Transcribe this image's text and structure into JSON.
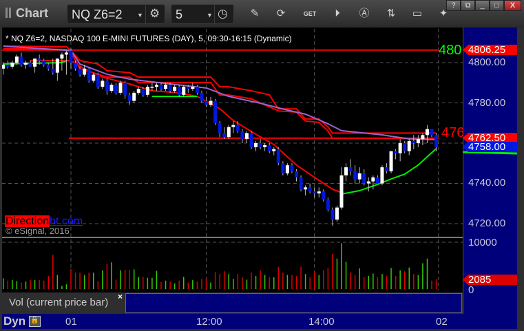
{
  "window": {
    "title": "Chart",
    "buttons": [
      "?",
      "⧉",
      "_",
      "□",
      "X"
    ]
  },
  "toolbar": {
    "symbol": "NQ Z6=2",
    "interval": "5",
    "icons": [
      "gear-icon",
      "clock-icon",
      "pencil-icon",
      "chart-refresh-icon",
      "get-icon",
      "play-icon",
      "alert-icon",
      "swap-icon",
      "comment-icon",
      "twitter-icon"
    ]
  },
  "header": "* NQ Z6=2, NASDAQ 100 E-MINI FUTURES (DAY), 5, 09:30-16:15 (Dynamic)",
  "watermark": {
    "part1": "Direction",
    "part2": "ht.com",
    "copyright": "© eSignal, 2016"
  },
  "study_legend": {
    "label": "Vol (current price bar)",
    "close": "×"
  },
  "time_axis": {
    "mode": "Dyn",
    "labels": [
      "01",
      "12:00",
      "14:00",
      "02"
    ]
  },
  "price_axis": {
    "labels": [
      "4800.00",
      "4780.00",
      "4740.00",
      "4720.00"
    ],
    "flags": [
      {
        "text": "4806.25",
        "color": "#ff0000"
      },
      {
        "text": "4762.50",
        "color": "#ff0000"
      },
      {
        "text": "4758.00",
        "color": "#0018e0"
      }
    ],
    "line_labels": [
      {
        "text": "480",
        "color": "#00ff00"
      },
      {
        "text": "476",
        "color": "#ff0000"
      }
    ]
  },
  "volume_axis": {
    "labels": [
      "10000",
      "0"
    ],
    "flag": "2085"
  },
  "chart_data": {
    "type": "candlestick",
    "ylim": [
      4714,
      4818
    ],
    "grid": true,
    "colors": {
      "up": "#ffffff",
      "down": "#0018e0",
      "vol_up": "#33cc00",
      "vol_down": "#dd0000"
    },
    "bar_index_start": -15,
    "bars": [
      [
        4797,
        4800,
        4794,
        4799
      ],
      [
        4799,
        4801,
        4797,
        4798
      ],
      [
        4798,
        4801,
        4797,
        4800
      ],
      [
        4800,
        4804,
        4799,
        4803
      ],
      [
        4803,
        4805,
        4798,
        4799
      ],
      [
        4799,
        4801,
        4797,
        4800
      ],
      [
        4800,
        4801,
        4798,
        4798
      ],
      [
        4798,
        4802,
        4795,
        4802
      ],
      [
        4802,
        4804,
        4799,
        4801
      ],
      [
        4801,
        4802,
        4798,
        4799
      ],
      [
        4799,
        4800,
        4796,
        4797
      ],
      [
        4797,
        4802,
        4794,
        4795
      ],
      [
        4795,
        4802,
        4791,
        4802
      ],
      [
        4802,
        4805,
        4796,
        4804
      ],
      [
        4804,
        4806,
        4794,
        4805
      ],
      [
        4806,
        4807,
        4797,
        4800
      ],
      [
        4800,
        4801,
        4796,
        4797
      ],
      [
        4797,
        4798,
        4793,
        4794
      ],
      [
        4794,
        4799,
        4793,
        4797
      ],
      [
        4797,
        4798,
        4790,
        4791
      ],
      [
        4791,
        4795,
        4790,
        4794
      ],
      [
        4794,
        4795,
        4787,
        4788
      ],
      [
        4788,
        4792,
        4787,
        4791
      ],
      [
        4791,
        4792,
        4784,
        4786
      ],
      [
        4786,
        4790,
        4785,
        4789
      ],
      [
        4789,
        4790,
        4784,
        4785
      ],
      [
        4785,
        4791,
        4784,
        4790
      ],
      [
        4790,
        4791,
        4782,
        4784
      ],
      [
        4784,
        4785,
        4779,
        4781
      ],
      [
        4781,
        4786,
        4780,
        4785
      ],
      [
        4785,
        4788,
        4784,
        4787
      ],
      [
        4787,
        4788,
        4783,
        4784
      ],
      [
        4784,
        4789,
        4783,
        4788
      ],
      [
        4788,
        4790,
        4786,
        4788
      ],
      [
        4788,
        4790,
        4786,
        4789
      ],
      [
        4789,
        4790,
        4786,
        4787
      ],
      [
        4787,
        4790,
        4786,
        4789
      ],
      [
        4789,
        4790,
        4785,
        4786
      ],
      [
        4786,
        4789,
        4785,
        4788
      ],
      [
        4788,
        4789,
        4783,
        4784
      ],
      [
        4784,
        4789,
        4783,
        4788
      ],
      [
        4788,
        4789,
        4785,
        4787
      ],
      [
        4787,
        4790,
        4786,
        4788
      ],
      [
        4788,
        4789,
        4784,
        4785
      ],
      [
        4785,
        4786,
        4780,
        4781
      ],
      [
        4781,
        4783,
        4778,
        4779
      ],
      [
        4779,
        4783,
        4778,
        4781
      ],
      [
        4781,
        4782,
        4769,
        4770
      ],
      [
        4770,
        4771,
        4763,
        4765
      ],
      [
        4765,
        4768,
        4762,
        4763
      ],
      [
        4763,
        4769,
        4762,
        4768
      ],
      [
        4768,
        4771,
        4765,
        4769
      ],
      [
        4769,
        4771,
        4765,
        4766
      ],
      [
        4766,
        4767,
        4760,
        4762
      ],
      [
        4762,
        4766,
        4760,
        4765
      ],
      [
        4765,
        4766,
        4757,
        4758
      ],
      [
        4758,
        4761,
        4756,
        4760
      ],
      [
        4760,
        4762,
        4757,
        4758
      ],
      [
        4758,
        4760,
        4756,
        4759
      ],
      [
        4759,
        4760,
        4755,
        4756
      ],
      [
        4756,
        4758,
        4754,
        4757
      ],
      [
        4757,
        4758,
        4749,
        4750
      ],
      [
        4750,
        4751,
        4744,
        4745
      ],
      [
        4745,
        4750,
        4744,
        4749
      ],
      [
        4749,
        4750,
        4745,
        4746
      ],
      [
        4746,
        4747,
        4741,
        4743
      ],
      [
        4743,
        4744,
        4736,
        4737
      ],
      [
        4737,
        4739,
        4734,
        4738
      ],
      [
        4738,
        4740,
        4735,
        4736
      ],
      [
        4736,
        4738,
        4733,
        4735
      ],
      [
        4735,
        4738,
        4733,
        4736
      ],
      [
        4736,
        4737,
        4731,
        4732
      ],
      [
        4732,
        4733,
        4726,
        4727
      ],
      [
        4727,
        4728,
        4719,
        4722
      ],
      [
        4722,
        4729,
        4721,
        4728
      ],
      [
        4728,
        4748,
        4727,
        4744
      ],
      [
        4744,
        4750,
        4741,
        4748
      ],
      [
        4748,
        4752,
        4744,
        4746
      ],
      [
        4746,
        4749,
        4740,
        4742
      ],
      [
        4742,
        4748,
        4740,
        4745
      ],
      [
        4745,
        4747,
        4739,
        4740
      ],
      [
        4740,
        4743,
        4736,
        4741
      ],
      [
        4741,
        4744,
        4737,
        4743
      ],
      [
        4743,
        4744,
        4740,
        4740
      ],
      [
        4740,
        4749,
        4739,
        4748
      ],
      [
        4748,
        4750,
        4745,
        4746
      ],
      [
        4746,
        4756,
        4745,
        4756
      ],
      [
        4756,
        4757,
        4752,
        4755
      ],
      [
        4755,
        4762,
        4751,
        4760
      ],
      [
        4760,
        4761,
        4755,
        4756
      ],
      [
        4756,
        4762,
        4754,
        4761
      ],
      [
        4761,
        4764,
        4757,
        4760
      ],
      [
        4760,
        4764,
        4758,
        4762
      ],
      [
        4762,
        4765,
        4759,
        4764
      ],
      [
        4764,
        4769,
        4760,
        4767
      ],
      [
        4767,
        4767,
        4763,
        4764
      ],
      [
        4764,
        4765,
        4756,
        4758
      ]
    ],
    "volume": [
      2300,
      1800,
      1900,
      1700,
      1400,
      1600,
      1900,
      1900,
      1900,
      1800,
      2800,
      7300,
      3000,
      700,
      1000,
      4300,
      3500,
      3500,
      3000,
      3500,
      3500,
      1700,
      4000,
      5300,
      5700,
      2000,
      4000,
      4100,
      4100,
      4200,
      2600,
      2600,
      2400,
      2400,
      3900,
      1500,
      1800,
      1600,
      1200,
      1800,
      2600,
      1400,
      1900,
      1600,
      2200,
      2200,
      1400,
      3600,
      3200,
      3800,
      3200,
      2200,
      3200,
      2500,
      2000,
      3500,
      2800,
      4000,
      3000,
      2500,
      2500,
      4700,
      3500,
      3000,
      3000,
      2800,
      4800,
      3200,
      2500,
      3600,
      3000,
      4000,
      4500,
      7500,
      6500,
      9800,
      5800,
      3500,
      3000,
      4400,
      2500,
      2800,
      3300,
      2500,
      3200,
      2800,
      4500,
      2800,
      4000,
      3800,
      4600,
      3200,
      3000,
      5500,
      6500,
      1800,
      2085
    ],
    "volume_ylim": [
      0,
      10000
    ],
    "hlines": [
      {
        "value": 4806.25,
        "from_bar": -15,
        "color": "#ff0000"
      },
      {
        "value": 4762.5,
        "from_bar": 0,
        "color": "#ff0000"
      }
    ],
    "overlays": [
      {
        "color": "#ff0000",
        "points": [
          [
            -15,
            4808.2
          ],
          [
            -1,
            4807.9
          ],
          [
            0,
            4806
          ],
          [
            2,
            4801
          ],
          [
            6,
            4799.3
          ],
          [
            8,
            4796
          ],
          [
            13,
            4795
          ],
          [
            15,
            4792.8
          ],
          [
            31,
            4792.8
          ],
          [
            33,
            4788
          ],
          [
            35,
            4788
          ],
          [
            40,
            4786
          ],
          [
            44,
            4784
          ],
          [
            46,
            4777
          ],
          [
            50,
            4777
          ],
          [
            52,
            4772
          ],
          [
            55,
            4772
          ],
          [
            57,
            4768
          ],
          [
            58,
            4765
          ],
          [
            81,
            4765
          ]
        ]
      },
      {
        "color": "#ff0000",
        "points": [
          [
            -15,
            4807
          ],
          [
            -1,
            4806.5
          ],
          [
            0,
            4805
          ],
          [
            2,
            4797
          ],
          [
            6,
            4794.2
          ],
          [
            8,
            4792.8
          ],
          [
            13,
            4792.8
          ],
          [
            15,
            4790.1
          ],
          [
            31,
            4790.1
          ],
          [
            33,
            4783.9
          ],
          [
            35,
            4783.9
          ],
          [
            40,
            4782
          ],
          [
            46,
            4776
          ],
          [
            50,
            4775.4
          ],
          [
            52,
            4771
          ],
          [
            55,
            4770.3
          ],
          [
            57,
            4766
          ],
          [
            58,
            4762.4
          ],
          [
            81,
            4762.4
          ]
        ]
      },
      {
        "color": "#9966cc",
        "points": [
          [
            -15,
            4808.2
          ],
          [
            0,
            4806
          ],
          [
            2,
            4799.3
          ],
          [
            8,
            4794.2
          ],
          [
            13,
            4791.8
          ],
          [
            22,
            4789.4
          ],
          [
            30,
            4787.4
          ],
          [
            35,
            4783.2
          ],
          [
            42,
            4779.8
          ],
          [
            48,
            4776.4
          ],
          [
            52,
            4774.4
          ],
          [
            57,
            4769.6
          ],
          [
            60,
            4766.2
          ],
          [
            69,
            4764.1
          ],
          [
            75,
            4762.1
          ],
          [
            81,
            4761.7
          ]
        ]
      },
      {
        "color": "#ff0000",
        "points": [
          [
            -9,
            4801
          ],
          [
            -1,
            4801
          ],
          [
            0,
            4801
          ],
          [
            3,
            4796.9
          ],
          [
            7,
            4792.8
          ],
          [
            13,
            4789.4
          ],
          [
            18,
            4786
          ],
          [
            24,
            4785
          ],
          [
            28,
            4783.2
          ],
          [
            33,
            4777.1
          ],
          [
            36,
            4771.3
          ],
          [
            41,
            4764.4
          ],
          [
            45,
            4759.3
          ],
          [
            50,
            4749.1
          ],
          [
            55,
            4741.5
          ],
          [
            58,
            4737.1
          ],
          [
            60,
            4735.4
          ]
        ]
      },
      {
        "color": "#00ee00",
        "points": [
          [
            -15,
            4799.3
          ],
          [
            -2,
            4800
          ],
          [
            -1,
            4801
          ]
        ]
      },
      {
        "color": "#00ee00",
        "points": [
          [
            18,
            4783.2
          ],
          [
            28,
            4783.2
          ]
        ]
      },
      {
        "color": "#00ee00",
        "points": [
          [
            60,
            4734.7
          ],
          [
            64,
            4736.4
          ],
          [
            68,
            4739.5
          ],
          [
            71,
            4742.2
          ],
          [
            74,
            4744.6
          ],
          [
            77,
            4749.1
          ],
          [
            79,
            4753.2
          ],
          [
            81,
            4757.3
          ]
        ]
      }
    ]
  }
}
